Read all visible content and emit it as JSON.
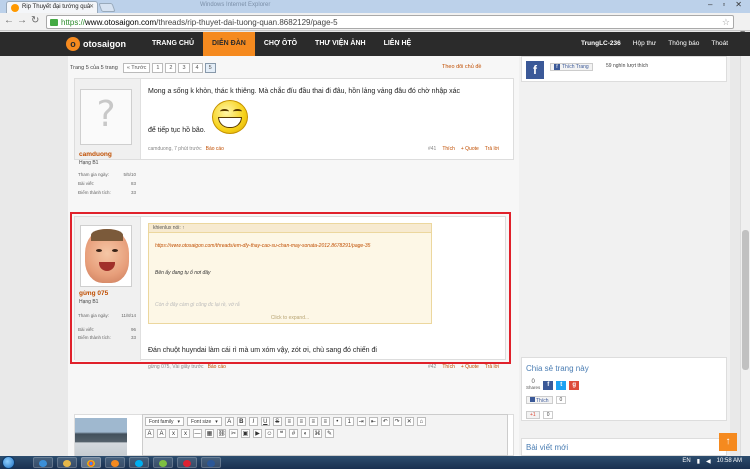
{
  "browser": {
    "tab_title": "Rip Thuyết đại tướng quâ",
    "titlebar_ghost": "Windows Internet Explorer",
    "url_prefix": "https://",
    "url_host": "www.otosaigon.com",
    "url_path": "/threads/rip-thuyet-dai-tuong-quan.8682129/page-5"
  },
  "site": {
    "logo_text": "otosaigon",
    "logo_initial": "o",
    "nav": [
      "TRANG CHỦ",
      "DIỄN ĐÀN",
      "CHỢ ÔTÔ",
      "THƯ VIỆN ẢNH",
      "LIÊN HỆ"
    ],
    "active_nav_index": 1,
    "user_nav": {
      "user": "TrungLC-236",
      "inbox": "Hộp thư",
      "alerts": "Thông báo",
      "logout": "Thoát"
    }
  },
  "pagination": {
    "label": "Trang 5 của 5 trang",
    "prev": "« Trước",
    "pages": [
      "1",
      "2",
      "3",
      "4",
      "5"
    ],
    "current": "5",
    "follow": "Theo dõi chủ đề"
  },
  "post1": {
    "username": "camduong",
    "rank": "Hạng B1",
    "stats": [
      {
        "label": "Tham gia ngày:",
        "value": "5/5/10"
      },
      {
        "label": "Bài viết:",
        "value": "83"
      },
      {
        "label": "Điểm thành tích:",
        "value": "33"
      }
    ],
    "line1": "Mong a sống k khỏn, thác k thiêng. Mà chắc đíu đầu thai đi đâu, hồn lảng vảng đâu đó chờ nhập xác",
    "line2": "để tiếp tục hồ bão.",
    "meta": "camduong, 7 phút trước",
    "report": "Báo cáo",
    "post_no": "#41",
    "like": "Thích",
    "quote": "+ Quote",
    "reply": "Trả lời"
  },
  "post2": {
    "username": "gừng 075",
    "rank": "Hạng B1",
    "stats": [
      {
        "label": "Tham gia ngày:",
        "value": "11/8/14"
      },
      {
        "label": "Bài viết:",
        "value": "96"
      },
      {
        "label": "Điểm thành tích:",
        "value": "33"
      }
    ],
    "quote_author": "khienlux nói: ↑",
    "quote_link": "https://www.otosaigon.com/threads/em-dly-thay-cao-su-chan-may-sonata-2012.8678291/page-35",
    "quote_text": "Bên ấy đang tụ ổ nơi đây",
    "quote_faded": "Còn ở đây càm gì cũng đc lại rề, vớ rắ",
    "expand": "Click to expand...",
    "body": "Đán chuột huyndai làm cái rì mà um xóm vậy, zót ơi, chù sang đó chiến đi",
    "meta": "gừng 075, Vài giây trước",
    "report": "Báo cáo",
    "post_no": "#42",
    "like": "Thích",
    "quote": "+ Quote",
    "reply": "Trả lời"
  },
  "sidebar": {
    "fb_like": "Thích Trang",
    "fb_count": "59 nghìn lượt thích",
    "share_title": "Chia sẻ trang này",
    "share_count": "0",
    "share_label": "Shares",
    "like_btn": "Thích",
    "like_count": "0",
    "gplus_count": "0",
    "gplus_label": "+1",
    "latest_title": "Bài viết mới"
  },
  "editor": {
    "font_family": "Font family",
    "font_size": "Font size"
  },
  "taskbar": {
    "lang": "EN",
    "time": "10:58 AM"
  }
}
